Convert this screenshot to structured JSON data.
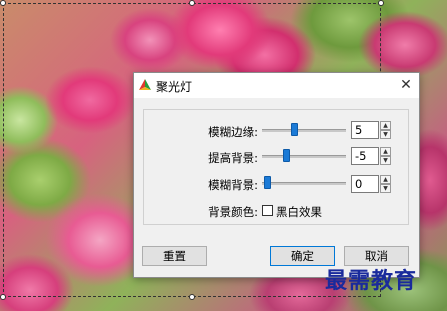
{
  "dialog": {
    "title": "聚光灯",
    "close_glyph": "✕",
    "rows": [
      {
        "label": "模糊边缘:",
        "value": "5",
        "slider_fraction": 0.38
      },
      {
        "label": "提高背景:",
        "value": "-5",
        "slider_fraction": 0.27
      },
      {
        "label": "模糊背景:",
        "value": "0",
        "slider_fraction": 0.02
      }
    ],
    "bg_color_label": "背景颜色:",
    "bw_checkbox_label": "黑白效果",
    "bw_checked": false,
    "reset_label": "重置",
    "ok_label": "确定",
    "cancel_label": "取消"
  },
  "watermark": "最需教育",
  "colors": {
    "slider_thumb": "#1b7ad6",
    "watermark": "#1a2a9c"
  }
}
